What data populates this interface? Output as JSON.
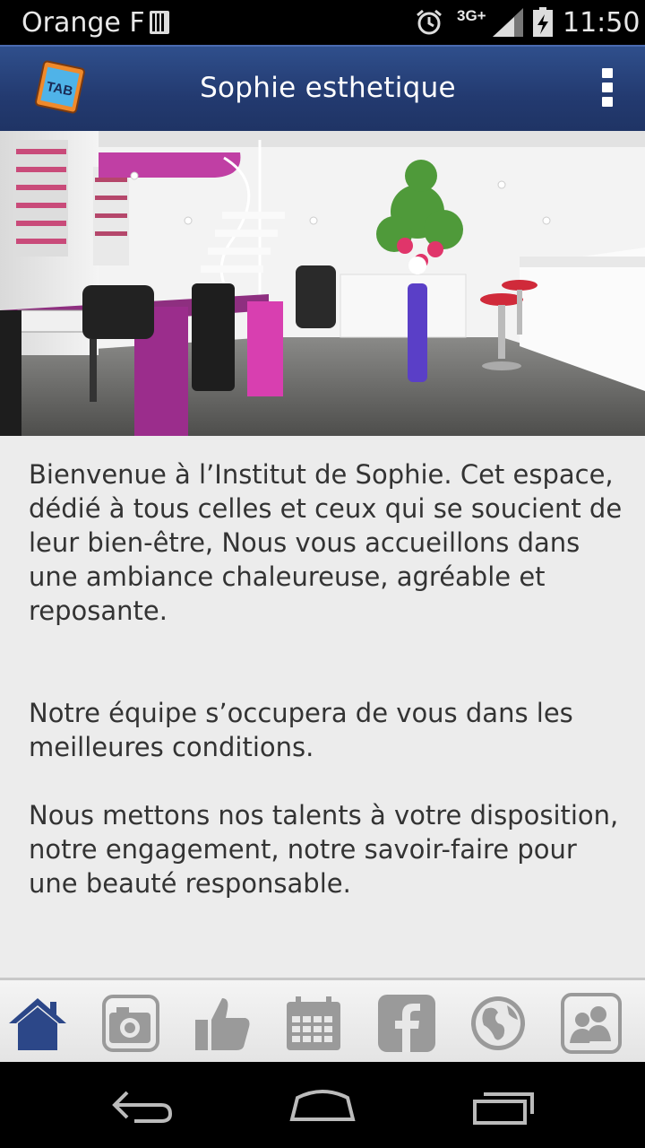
{
  "status_bar": {
    "carrier": "Orange F",
    "network": "3G+",
    "time": "11:50",
    "icons": [
      "sim-icon",
      "alarm-icon",
      "signal-icon",
      "battery-charging-icon"
    ]
  },
  "action_bar": {
    "logo_text": "TAB",
    "title": "Sophie esthetique",
    "menu_icon": "overflow-menu-icon"
  },
  "hero": {
    "image": "salon-interior-photo"
  },
  "content": {
    "paragraphs": [
      "Bienvenue à l’Institut de Sophie. Cet espace, dédié à tous celles et ceux qui se soucient de leur bien-être, Nous vous accueillons dans une ambiance chaleureuse, agréable et reposante.",
      "Notre équipe s’occupera de vous dans les meilleures conditions.",
      "Nous mettons nos talents à votre disposition, notre engagement, notre savoir-faire pour une beauté responsable."
    ]
  },
  "tabs": [
    {
      "icon": "home-icon",
      "active": true
    },
    {
      "icon": "camera-icon",
      "active": false
    },
    {
      "icon": "thumbs-up-icon",
      "active": false
    },
    {
      "icon": "calendar-icon",
      "active": false
    },
    {
      "icon": "facebook-icon",
      "active": false
    },
    {
      "icon": "globe-icon",
      "active": false
    },
    {
      "icon": "contacts-icon",
      "active": false
    }
  ],
  "nav_bar": {
    "icons": [
      "back-icon",
      "home-nav-icon",
      "recent-apps-icon"
    ]
  },
  "colors": {
    "action_bar": "#233a70",
    "active_tab": "#2c4788",
    "inactive_tab": "#9a9a9a",
    "content_bg": "#ececec",
    "text": "#333333"
  }
}
